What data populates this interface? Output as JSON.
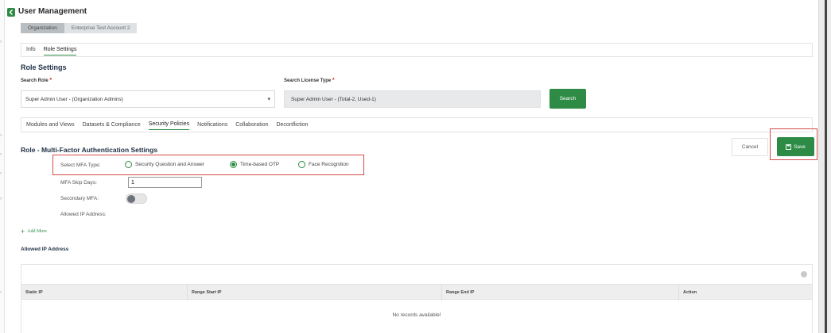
{
  "header": {
    "title": "User Management",
    "breadcrumb": [
      "Organization",
      "Enterprise Test Account 2"
    ]
  },
  "top_tabs": [
    {
      "label": "Info",
      "active": false
    },
    {
      "label": "Role Settings",
      "active": true
    }
  ],
  "role_settings": {
    "title": "Role Settings",
    "search_role_label": "Search Role",
    "search_role_value": "Super Admin User - (Organization Admins)",
    "license_label": "Search License Type",
    "license_value": "Super Admin User - (Total-2, Used-1)",
    "search_button": "Search",
    "required_mark": "*"
  },
  "policy_tabs": [
    {
      "label": "Modules and Views",
      "active": false
    },
    {
      "label": "Datasets & Compliance",
      "active": false
    },
    {
      "label": "Security Policies",
      "active": true
    },
    {
      "label": "Notifications",
      "active": false
    },
    {
      "label": "Collaboration",
      "active": false
    },
    {
      "label": "Deconfliction",
      "active": false
    }
  ],
  "mfa": {
    "title": "Role - Multi-Factor Authentication Settings",
    "cancel_label": "Cancel",
    "save_label": "Save",
    "type_label": "Select MFA Type:",
    "options": [
      {
        "label": "Security Question and Answer",
        "selected": false
      },
      {
        "label": "Time-based OTP",
        "selected": true
      },
      {
        "label": "Face Recognition",
        "selected": false
      }
    ],
    "skip_days_label": "MFA Skip Days:",
    "skip_days_value": "1",
    "secondary_label": "Secondary MFA:",
    "secondary_enabled": false,
    "allowed_ip_label": "Allowed IP Address:",
    "add_more_label": "Add More"
  },
  "ip_table": {
    "title": "Allowed IP Address",
    "columns": [
      "Static IP",
      "Range Start IP",
      "Range End IP",
      "Action"
    ],
    "empty_message": "No records available!"
  },
  "colors": {
    "accent": "#2e8b45",
    "highlight": "#d64a4a"
  }
}
